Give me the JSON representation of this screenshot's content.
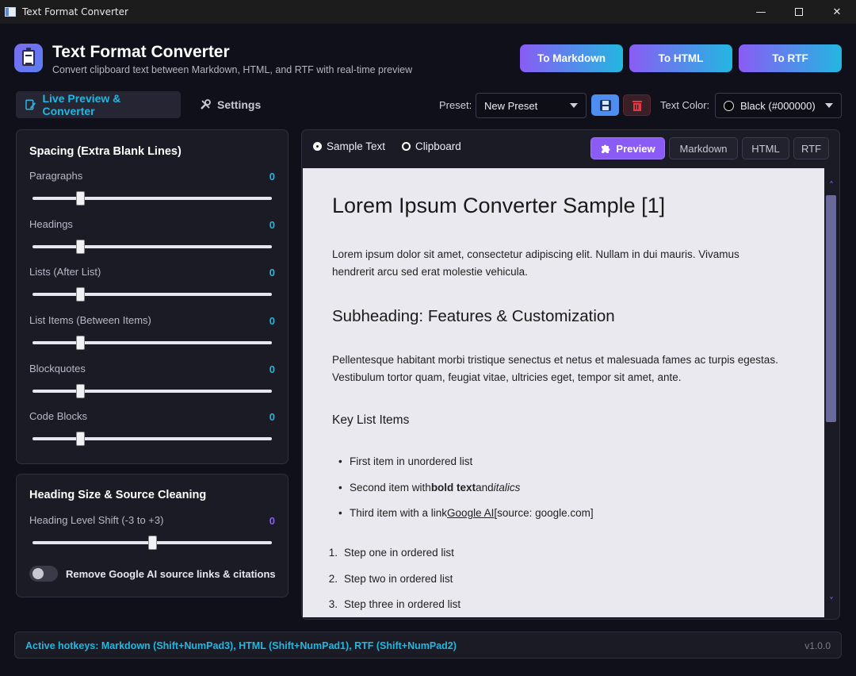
{
  "window": {
    "title": "Text Format Converter"
  },
  "header": {
    "title": "Text Format Converter",
    "subtitle": "Convert clipboard text between Markdown, HTML, and RTF with real-time preview",
    "buttons": [
      "To Markdown",
      "To HTML",
      "To RTF"
    ]
  },
  "tabs": {
    "live": "Live Preview & Converter",
    "settings": "Settings"
  },
  "toolbar": {
    "preset_label": "Preset:",
    "preset_value": "New Preset",
    "text_color_label": "Text Color:",
    "text_color_value": "Black (#000000)"
  },
  "spacing": {
    "title": "Spacing (Extra Blank Lines)",
    "items": [
      {
        "label": "Paragraphs",
        "value": "0",
        "fraction": 0.2
      },
      {
        "label": "Headings",
        "value": "0",
        "fraction": 0.2
      },
      {
        "label": "Lists (After List)",
        "value": "0",
        "fraction": 0.2
      },
      {
        "label": "List Items (Between Items)",
        "value": "0",
        "fraction": 0.2
      },
      {
        "label": "Blockquotes",
        "value": "0",
        "fraction": 0.2
      },
      {
        "label": "Code Blocks",
        "value": "0",
        "fraction": 0.2
      }
    ]
  },
  "heading": {
    "title": "Heading Size & Source Cleaning",
    "shift_label": "Heading Level Shift (-3 to +3)",
    "shift_value": "0",
    "shift_fraction": 0.5,
    "toggle_label": "Remove Google AI source links & citations",
    "toggle_on": false
  },
  "source": {
    "sample": "Sample Text",
    "clipboard": "Clipboard",
    "selected": "sample"
  },
  "formats": [
    "Preview",
    "Markdown",
    "HTML",
    "RTF"
  ],
  "preview": {
    "h1": "Lorem Ipsum Converter Sample [1]",
    "p1a": "Lorem ipsum dolor sit amet, consectetur adipiscing elit. Nullam in dui mauris. Vivamus",
    "p1b": "hendrerit arcu sed erat molestie vehicula.",
    "h2": "Subheading: Features & Customization",
    "p2a": "Pellentesque habitant morbi tristique senectus et netus et malesuada fames ac turpis egestas.",
    "p2b": "Vestibulum tortor quam, feugiat vitae, ultricies eget, tempor sit amet, ante.",
    "h3": "Key List Items",
    "ul1": "First item in unordered list",
    "ul2_pre": "Second item with",
    "ul2_bold": "bold text",
    "ul2_mid": "and",
    "ul2_it": "italics",
    "ul3_pre": "Third item with a link",
    "ul3_link": "Google AI",
    "ul3_post": "[source: google.com]",
    "ol": [
      "Step one in ordered list",
      "Step two in ordered list",
      "Step three in ordered list"
    ]
  },
  "status": {
    "hotkeys": "Active hotkeys: Markdown (Shift+NumPad3), HTML (Shift+NumPad1), RTF (Shift+NumPad2)",
    "version": "v1.0.0"
  },
  "colors": {
    "accent_cyan": "#22b7e0",
    "accent_purple": "#8a5cf5",
    "danger": "#e03a4a"
  }
}
